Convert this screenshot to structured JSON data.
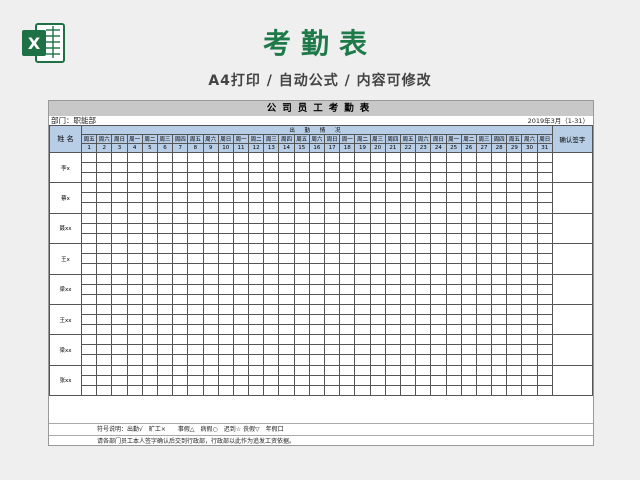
{
  "page": {
    "title": "考勤表",
    "subtitle": "A4打印 / 自动公式 / 内容可修改"
  },
  "sheet": {
    "title": "公司员工考勤表",
    "department": "部门：职能部",
    "month": "2019年3月（1-31）",
    "name_header": "姓 名",
    "attendance_header": "出 勤 情 况",
    "confirm_header": "确认签字",
    "weekdays": [
      "周五",
      "周六",
      "周日",
      "周一",
      "周二",
      "周三",
      "周四",
      "周五",
      "周六",
      "周日",
      "周一",
      "周二",
      "周三",
      "周四",
      "周五",
      "周六",
      "周日",
      "周一",
      "周二",
      "周三",
      "周四",
      "周五",
      "周六",
      "周日",
      "周一",
      "周二",
      "周三",
      "周四",
      "周五",
      "周六",
      "周日"
    ],
    "days": [
      "1",
      "2",
      "3",
      "4",
      "5",
      "6",
      "7",
      "8",
      "9",
      "10",
      "11",
      "12",
      "13",
      "14",
      "15",
      "16",
      "17",
      "18",
      "19",
      "20",
      "21",
      "22",
      "23",
      "24",
      "25",
      "26",
      "27",
      "28",
      "29",
      "30",
      "31"
    ],
    "employees": [
      "李x",
      "蔡x",
      "聂xx",
      "王x",
      "梁xx",
      "王xx",
      "梁xx",
      "张xx"
    ],
    "legend": "符号说明：出勤√　旷工×　　事假△　病假○　迟到☆ 丧假▽　年假口",
    "instruction": "请各部门员工本人签字确认后交到行政部，行政部以此作为追发工资依据。"
  },
  "colors": {
    "title_green": "#1f7a4a",
    "header_blue": "#b8cde6",
    "excel_green": "#1e7145"
  },
  "icons": {
    "logo": "excel-icon"
  }
}
